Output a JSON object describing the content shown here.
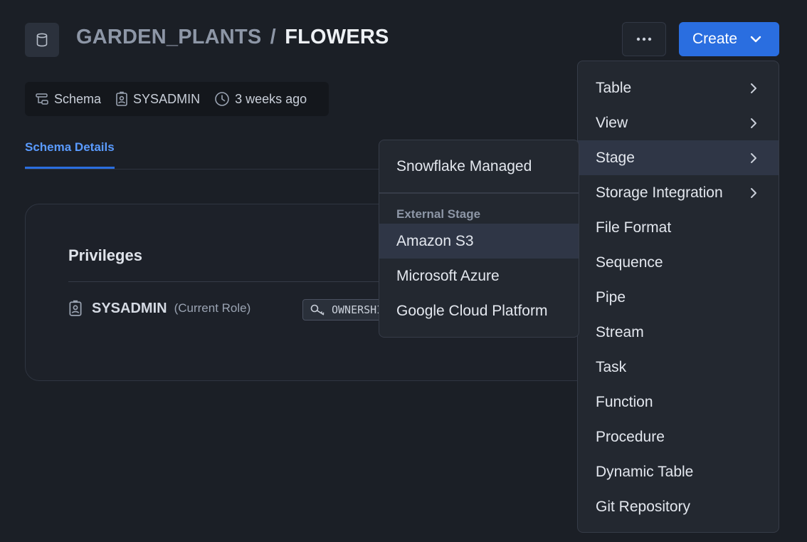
{
  "header": {
    "parent": "GARDEN_PLANTS",
    "separator": "/",
    "current": "FLOWERS",
    "create_label": "Create"
  },
  "meta": {
    "type": "Schema",
    "owner": "SYSADMIN",
    "modified": "3 weeks ago"
  },
  "tabs": [
    {
      "label": "Schema Details",
      "active": true
    }
  ],
  "privileges": {
    "title": "Privileges",
    "role": "SYSADMIN",
    "current_label": "(Current Role)",
    "privilege": "OWNERSHIP"
  },
  "create_menu": {
    "items": [
      {
        "label": "Table",
        "submenu": true
      },
      {
        "label": "View",
        "submenu": true
      },
      {
        "label": "Stage",
        "submenu": true,
        "active": true
      },
      {
        "label": "Storage Integration",
        "submenu": true
      },
      {
        "label": "File Format",
        "submenu": false
      },
      {
        "label": "Sequence",
        "submenu": false
      },
      {
        "label": "Pipe",
        "submenu": false
      },
      {
        "label": "Stream",
        "submenu": false
      },
      {
        "label": "Task",
        "submenu": false
      },
      {
        "label": "Function",
        "submenu": false
      },
      {
        "label": "Procedure",
        "submenu": false
      },
      {
        "label": "Dynamic Table",
        "submenu": false
      },
      {
        "label": "Git Repository",
        "submenu": false
      }
    ]
  },
  "stage_submenu": {
    "managed": "Snowflake Managed",
    "external_group": "External Stage",
    "external_items": [
      {
        "label": "Amazon S3",
        "active": true
      },
      {
        "label": "Microsoft Azure",
        "active": false
      },
      {
        "label": "Google Cloud Platform",
        "active": false
      }
    ]
  },
  "colors": {
    "accent": "#2a6ee0",
    "tab_active": "#5a9bff",
    "background": "#1b1f26"
  }
}
